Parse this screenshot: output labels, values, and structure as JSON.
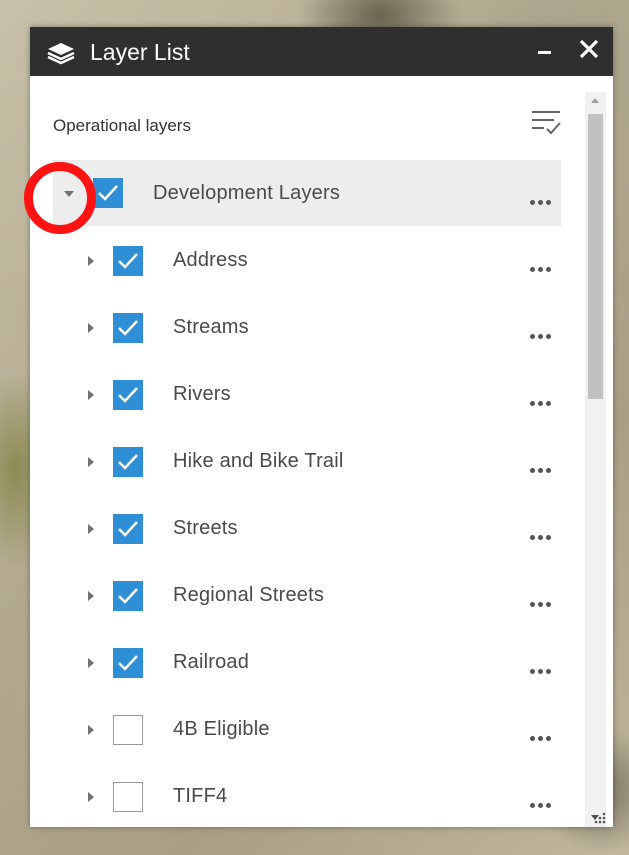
{
  "widget": {
    "title": "Layer List",
    "icon": "layers-icon",
    "minimize": "minimize-icon",
    "close": "close-icon"
  },
  "section_title": "Operational layers",
  "filter_icon": "filter-list-icon",
  "parent_layer": {
    "label": "Development Layers",
    "checked": true,
    "expanded": true
  },
  "layers": [
    {
      "label": "Address",
      "checked": true
    },
    {
      "label": "Streams",
      "checked": true
    },
    {
      "label": "Rivers",
      "checked": true
    },
    {
      "label": "Hike and Bike Trail",
      "checked": true
    },
    {
      "label": "Streets",
      "checked": true
    },
    {
      "label": "Regional Streets",
      "checked": true
    },
    {
      "label": "Railroad",
      "checked": true
    },
    {
      "label": "4B Eligible",
      "checked": false
    },
    {
      "label": "TIFF4",
      "checked": false
    }
  ],
  "colors": {
    "titlebar": "#2f2f2f",
    "checkbox_checked": "#2f8fd6",
    "highlight_annotation": "#ff1313",
    "parent_row_bg": "#ededed"
  }
}
